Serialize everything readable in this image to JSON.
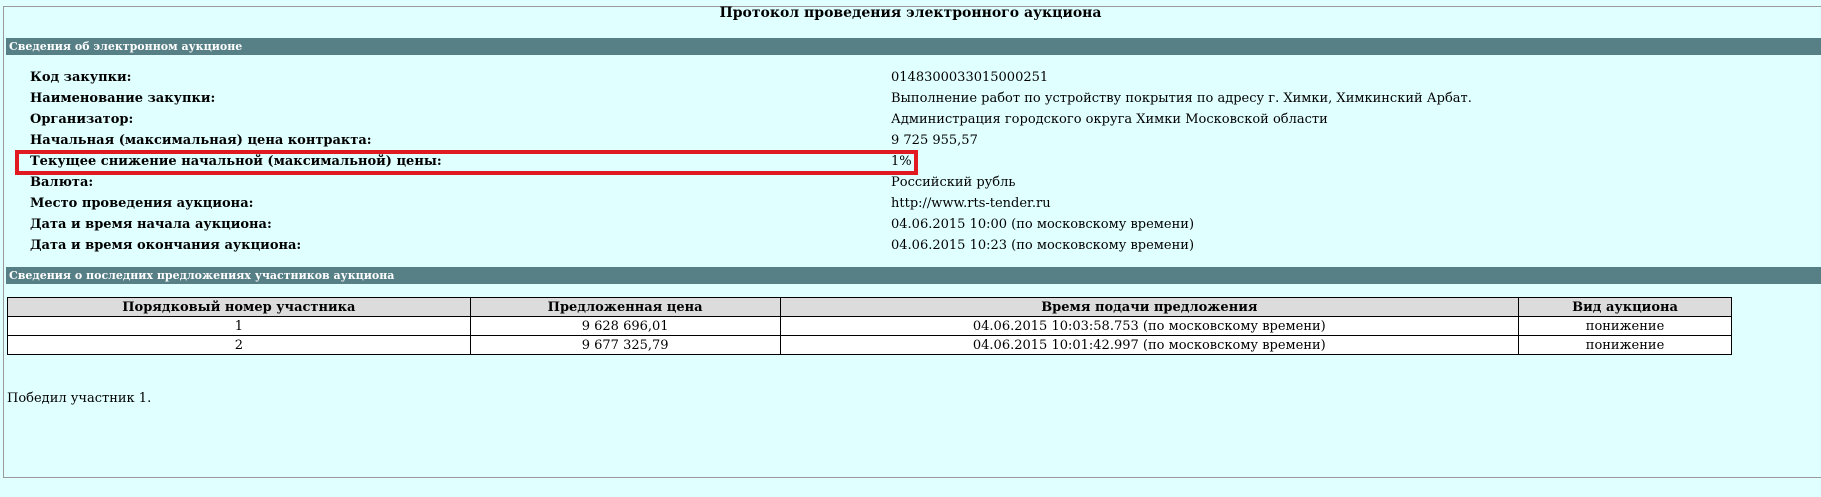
{
  "page_title": "Протокол проведения электронного аукциона",
  "section_auction_info": "Сведения об электронном аукционе",
  "auction_info": [
    {
      "label": "Код закупки:",
      "value": "0148300033015000251"
    },
    {
      "label": "Наименование закупки:",
      "value": "Выполнение работ по устройству покрытия по адресу г. Химки, Химкинский Арбат."
    },
    {
      "label": "Организатор:",
      "value": "Администрация городского округа Химки Московской области"
    },
    {
      "label": "Начальная (максимальная) цена контракта:",
      "value": "9 725 955,57"
    },
    {
      "label": "Текущее снижение начальной (максимальной) цены:",
      "value": "1%"
    },
    {
      "label": "Валюта:",
      "value": "Российский рубль"
    },
    {
      "label": "Место проведения аукциона:",
      "value": "http://www.rts-tender.ru"
    },
    {
      "label": "Дата и время начала аукциона:",
      "value": "04.06.2015 10:00 (по московскому времени)"
    },
    {
      "label": "Дата и время окончания аукциона:",
      "value": "04.06.2015 10:23 (по московскому времени)"
    }
  ],
  "section_bids": "Сведения о последних предложениях участников аукциона",
  "bids_table": {
    "headers": [
      "Порядковый номер участника",
      "Предложенная цена",
      "Время подачи предложения",
      "Вид аукциона"
    ],
    "rows": [
      [
        "1",
        "9 628 696,01",
        "04.06.2015 10:03:58.753 (по московскому времени)",
        "понижение"
      ],
      [
        "2",
        "9 677 325,79",
        "04.06.2015 10:01:42.997 (по московскому времени)",
        "понижение"
      ]
    ]
  },
  "winner_text": "Победил участник 1.",
  "colors": {
    "background": "#e0ffff",
    "section_bar": "#567f86",
    "highlight_border": "#e11a22",
    "table_header": "#dcdcdc"
  }
}
